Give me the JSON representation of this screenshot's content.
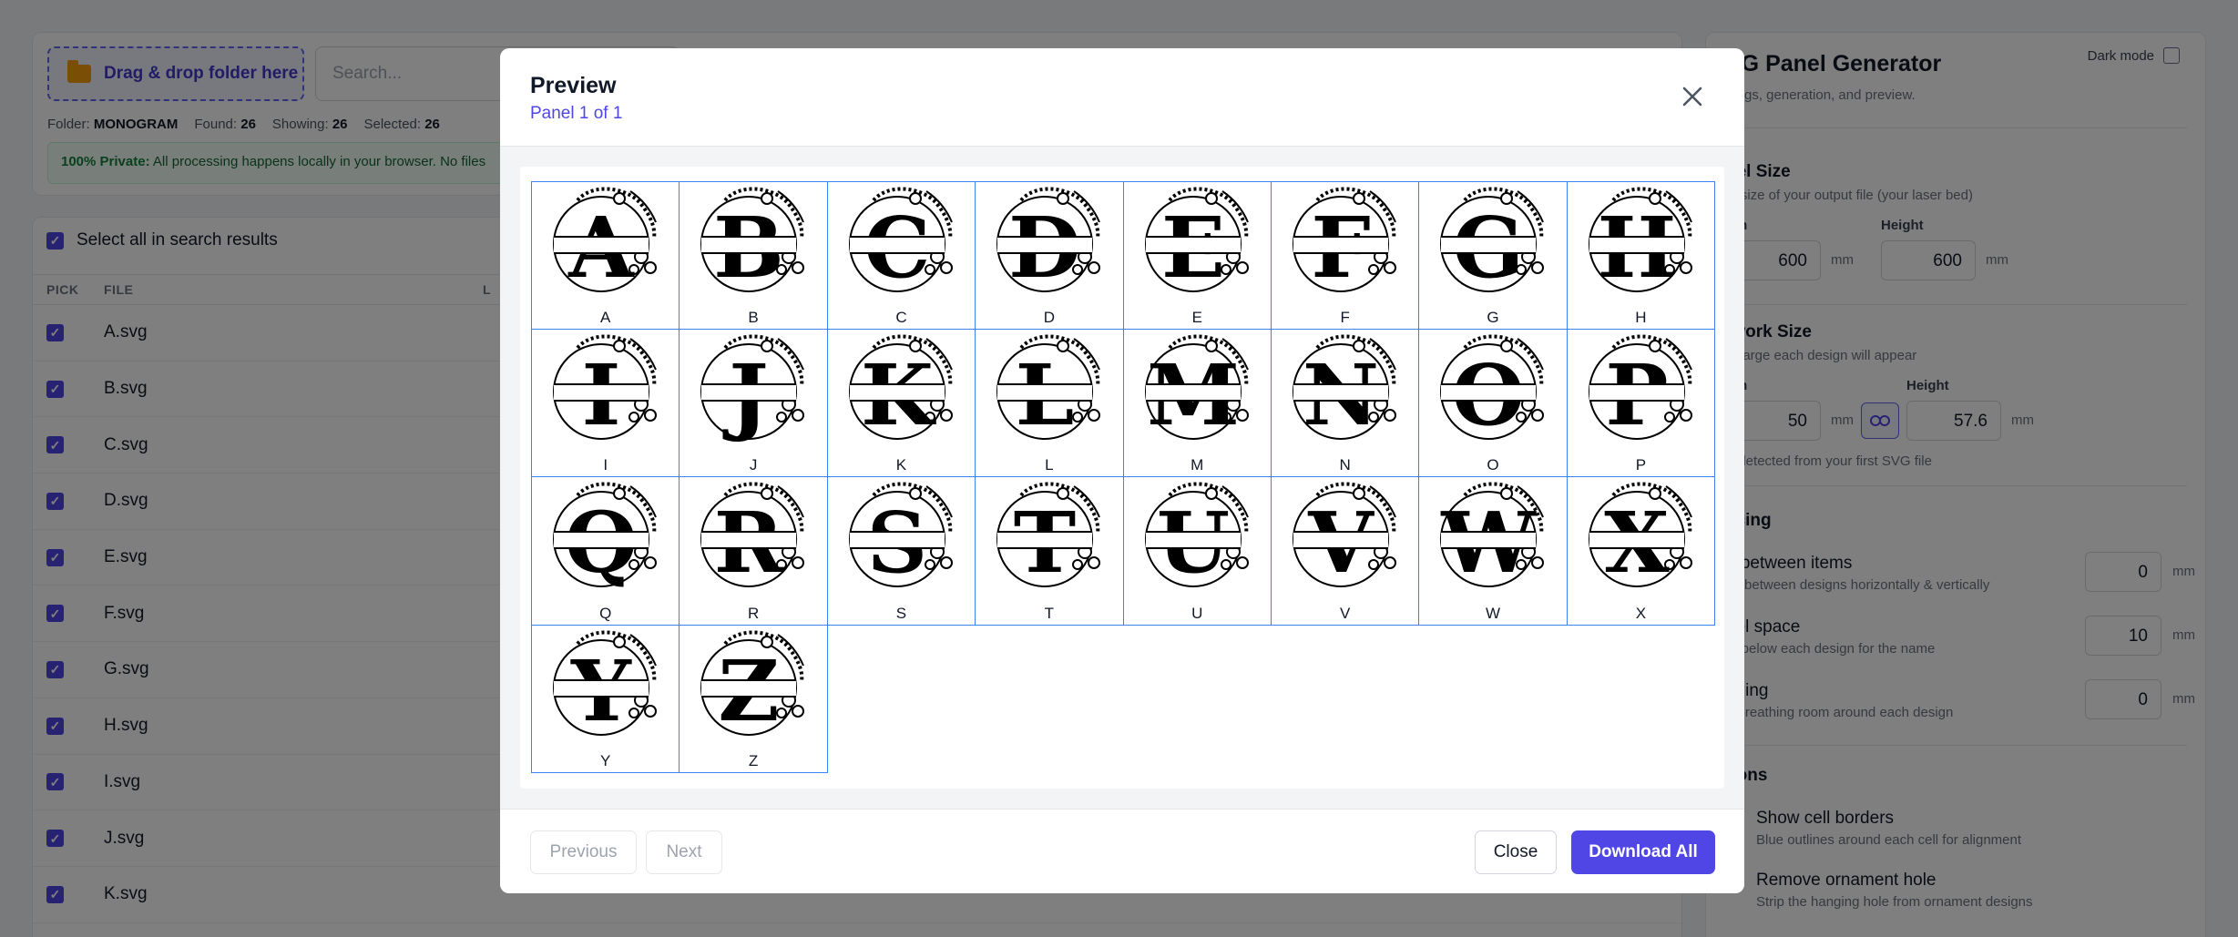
{
  "left": {
    "dropzone_label": "Drag & drop folder here",
    "search_placeholder": "Search...",
    "folder_label": "Folder:",
    "folder_value": "MONOGRAM",
    "found_label": "Found:",
    "found_value": "26",
    "showing_label": "Showing:",
    "showing_value": "26",
    "selected_label": "Selected:",
    "selected_value": "26",
    "private_strong": "100% Private:",
    "private_text": "All processing happens locally in your browser. No files",
    "select_all_label": "Select all in search results",
    "col_pick": "PICK",
    "col_file": "FILE",
    "col_extra": "L",
    "files": [
      "A.svg",
      "B.svg",
      "C.svg",
      "D.svg",
      "E.svg",
      "F.svg",
      "G.svg",
      "H.svg",
      "I.svg",
      "J.svg",
      "K.svg"
    ]
  },
  "right": {
    "title": "VG Panel Generator",
    "subtitle": "ttings, generation, and preview.",
    "dark_mode_label": "Dark mode",
    "panel_size_title": "nel Size",
    "panel_size_help": "al size of your output file (your laser bed)",
    "width_label": "dth",
    "height_label": "Height",
    "panel_width": "600",
    "panel_height": "600",
    "unit_mm": "mm",
    "artwork_title": "twork Size",
    "artwork_help": "w large each design will appear",
    "art_width_label": "dth",
    "art_height_label": "Height",
    "art_width": "50",
    "art_height": "57.6",
    "art_note": "o-detected from your first SVG file",
    "spacing_title": "acing",
    "gap_label": "p between items",
    "gap_help": "ce between designs horizontally & vertically",
    "gap_value": "0",
    "label_space_label": "bel space",
    "label_space_help": "m below each design for the name",
    "label_space_value": "10",
    "padding_label": "dding",
    "padding_help": "a breathing room around each design",
    "padding_value": "0",
    "options_title": "tions",
    "opt_borders_label": "Show cell borders",
    "opt_borders_help": "Blue outlines around each cell for alignment",
    "opt_hole_label": "Remove ornament hole",
    "opt_hole_help": "Strip the hanging hole from ornament designs"
  },
  "modal": {
    "title": "Preview",
    "subtitle": "Panel 1 of 1",
    "letters": [
      "A",
      "B",
      "C",
      "D",
      "E",
      "F",
      "G",
      "H",
      "I",
      "J",
      "K",
      "L",
      "M",
      "N",
      "O",
      "P",
      "Q",
      "R",
      "S",
      "T",
      "U",
      "V",
      "W",
      "X",
      "Y",
      "Z"
    ],
    "prev_label": "Previous",
    "next_label": "Next",
    "close_label": "Close",
    "download_label": "Download All"
  },
  "colors": {
    "accent": "#4f46e5",
    "cell_border": "#3b82f6",
    "private_bg": "#f0fdf4"
  }
}
